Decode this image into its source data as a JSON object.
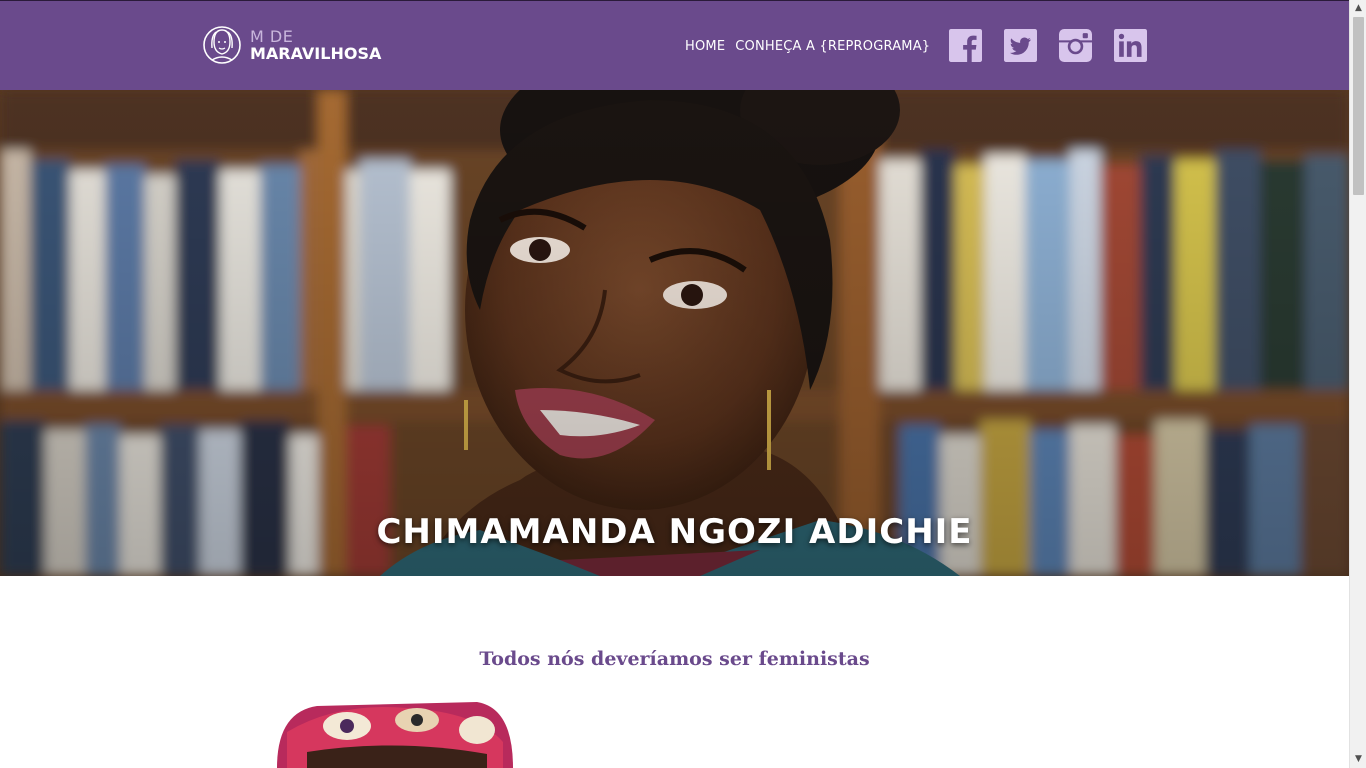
{
  "header": {
    "logo": {
      "line1": "M DE",
      "line2": "MARAVILHOSA"
    },
    "nav": [
      {
        "label": "HOME"
      },
      {
        "label": "CONHEÇA A {REPROGRAMA}"
      }
    ],
    "social": [
      {
        "icon": "facebook-icon"
      },
      {
        "icon": "twitter-icon"
      },
      {
        "icon": "instagram-icon"
      },
      {
        "icon": "linkedin-icon"
      }
    ],
    "colors": {
      "background": "#6a4a8c",
      "social_icon": "#d8c5ec"
    }
  },
  "hero": {
    "title": "CHIMAMANDA NGOZI ADICHIE",
    "image": "portrait-photo-in-front-of-bookshelves"
  },
  "content": {
    "section_title": "Todos nós deveríamos ser feministas",
    "image": "book-cover-photo"
  },
  "colors": {
    "accent": "#6a4a8c"
  }
}
